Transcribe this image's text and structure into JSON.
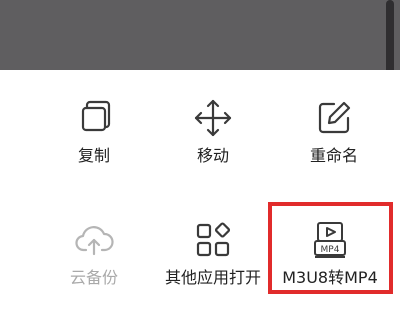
{
  "colors": {
    "overlay": "#5f5e60",
    "icon_stroke": "#3a3a3a",
    "icon_disabled": "#b5b5b5",
    "highlight_border": "#e12b2b"
  },
  "actions_row1": [
    {
      "label": "复制",
      "icon": "copy-icon"
    },
    {
      "label": "移动",
      "icon": "move-icon"
    },
    {
      "label": "重命名",
      "icon": "rename-icon"
    }
  ],
  "actions_row2": [
    {
      "label": "云备份",
      "icon": "cloud-upload-icon",
      "disabled": true
    },
    {
      "label": "其他应用打开",
      "icon": "apps-icon"
    },
    {
      "label": "M3U8转MP4",
      "icon": "convert-mp4-icon",
      "highlighted": true
    }
  ],
  "mp4_badge": "MP4"
}
